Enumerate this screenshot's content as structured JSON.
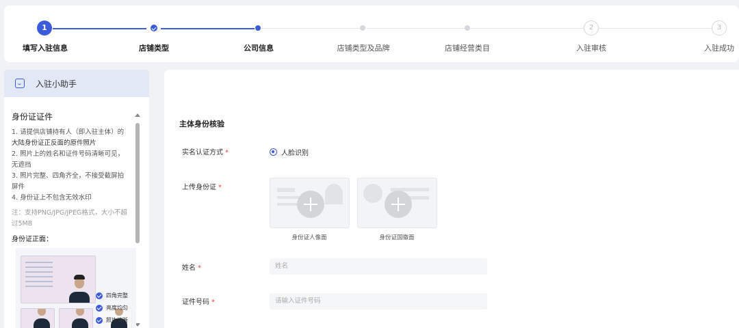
{
  "stepper": {
    "steps": [
      {
        "number": "1",
        "label": "填写入驻信息",
        "state": "active"
      },
      {
        "label": "店铺类型",
        "state": "done"
      },
      {
        "label": "公司信息",
        "state": "current"
      },
      {
        "label": "店铺类型及品牌",
        "state": "pending"
      },
      {
        "label": "店铺经营类目",
        "state": "pending"
      },
      {
        "number": "2",
        "label": "入驻审核",
        "state": "pending"
      },
      {
        "number": "3",
        "label": "入驻成功",
        "state": "pending"
      }
    ]
  },
  "helper": {
    "title": "入驻小助手",
    "section_title": "身份证证件",
    "tips": [
      "1. 请提供店铺持有人（即入驻主体）的",
      "大陆身份证正反面的原件照片",
      "2. 照片上的姓名和证件号码清晰可见，",
      "无遮挡",
      "3. 照片完整、四角齐全，不接受截屏拍",
      "屏件",
      "4. 身份证上不包含无效水印"
    ],
    "note": "注：支持PNG/JPG/JPEG格式，大小不超过5MB",
    "sample_title": "身份证正面：",
    "checks": [
      "四角完整",
      "亮度均匀",
      "照片清晰"
    ]
  },
  "form": {
    "section_title": "主体身份核验",
    "verify_method_label": "实名认证方式",
    "verify_method_value": "人脸识别",
    "upload_label": "上传身份证",
    "upload_front_caption": "身份证人像面",
    "upload_back_caption": "身份证国徽面",
    "name_label": "姓名",
    "name_placeholder": "姓名",
    "id_label": "证件号码",
    "id_placeholder": "请输入证件号码",
    "required_mark": "*"
  },
  "colors": {
    "accent": "#3b5bdb",
    "required": "#e64545",
    "page_bg": "#f0f2f5"
  }
}
